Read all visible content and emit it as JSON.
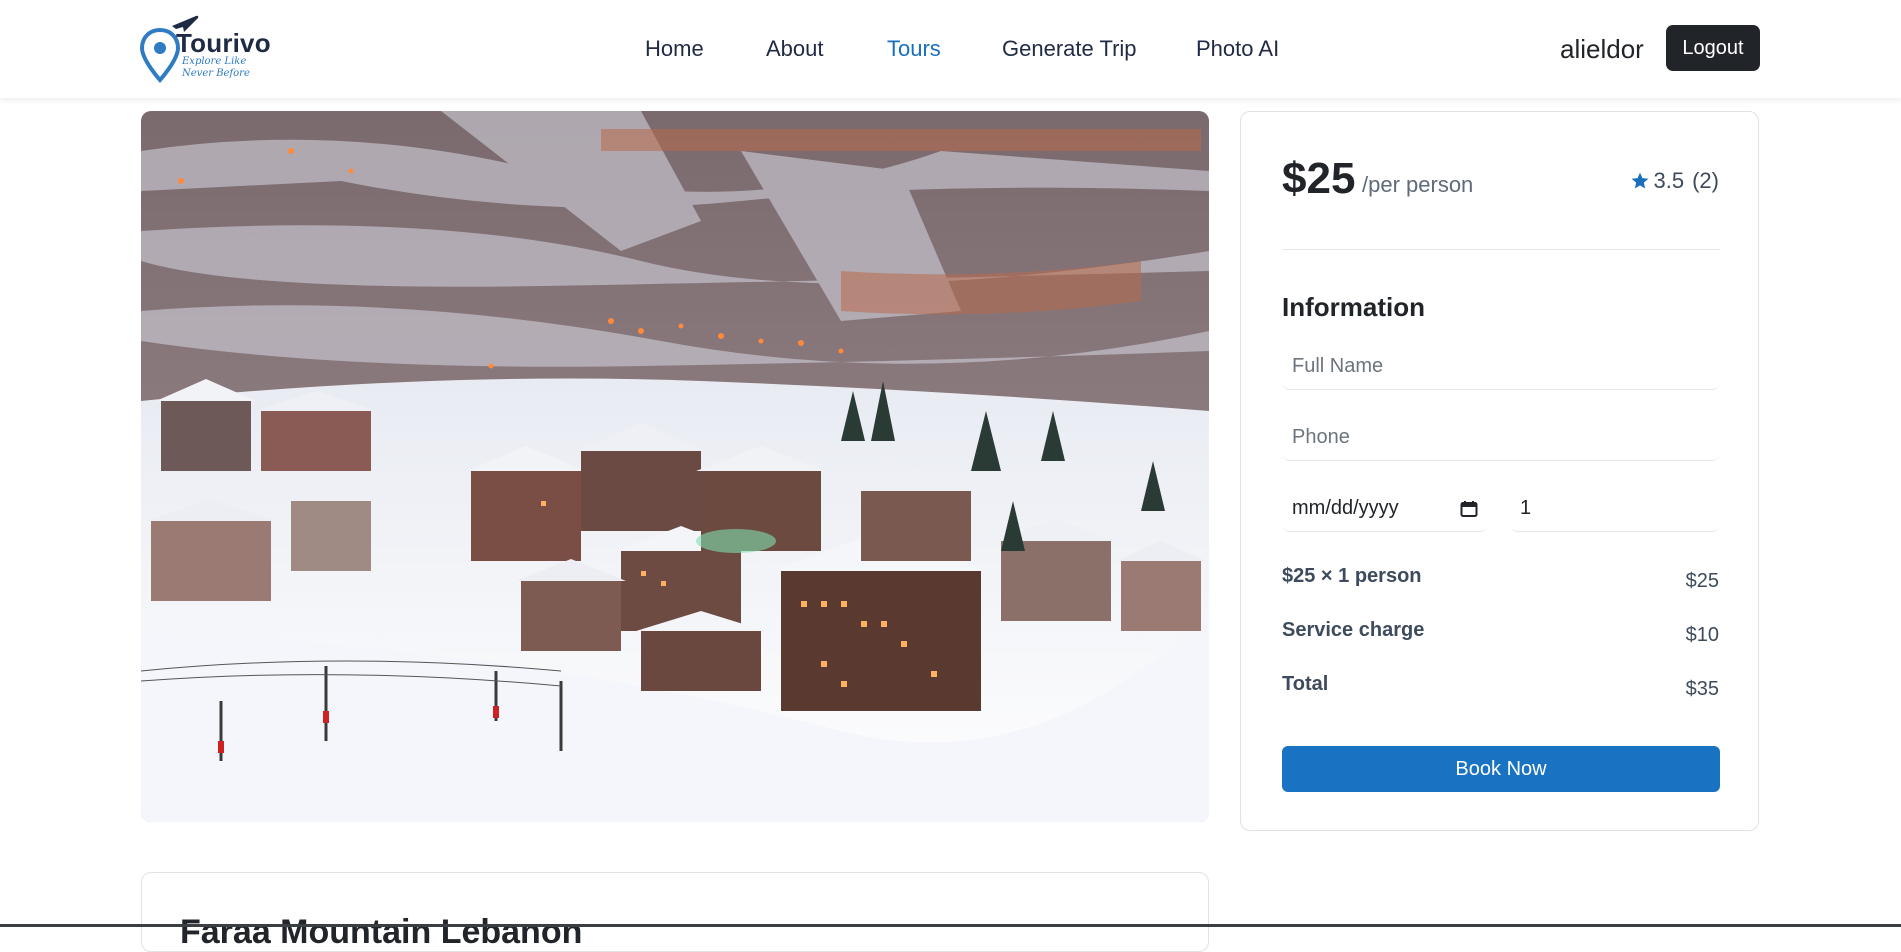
{
  "brand": {
    "name": "Tourivo",
    "tagline": "Explore Like Never Before"
  },
  "nav": {
    "items": [
      {
        "label": "Home",
        "active": false
      },
      {
        "label": "About",
        "active": false
      },
      {
        "label": "Tours",
        "active": true
      },
      {
        "label": "Generate Trip",
        "active": false
      },
      {
        "label": "Photo AI",
        "active": false
      }
    ]
  },
  "user": {
    "username": "alieldor",
    "logout_label": "Logout"
  },
  "hero": {
    "image": "snowy-mountain-ski-village"
  },
  "booking": {
    "price": "$25",
    "price_unit": "/per person",
    "rating": "3.5",
    "rating_count": "(2)",
    "info_title": "Information",
    "name_placeholder": "Full Name",
    "phone_placeholder": "Phone",
    "date_placeholder": "mm/dd/yyyy",
    "guests_value": "1",
    "line_item_label": "$25  ×  1 person",
    "line_item_value": "$25",
    "service_label": "Service charge",
    "service_value": "$10",
    "total_label": "Total",
    "total_value": "$35",
    "book_label": "Book Now"
  },
  "details": {
    "title": "Faraa Mountain Lebanon"
  },
  "colors": {
    "accent": "#1a73c2",
    "nav_active": "#1a6fbd",
    "dark_button": "#212529"
  }
}
